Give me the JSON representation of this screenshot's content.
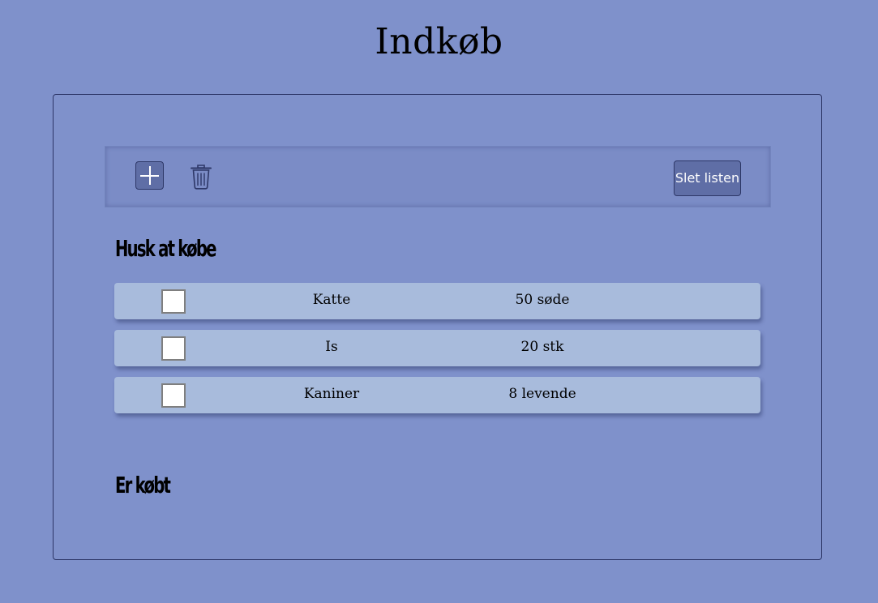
{
  "header": {
    "title": "Indkøb"
  },
  "toolbar": {
    "add_icon": "plus-icon",
    "delete_icon": "trash-icon",
    "clear_label": "Slet listen"
  },
  "sections": {
    "to_buy": {
      "heading": "Husk at købe",
      "items": [
        {
          "name": "Katte",
          "quantity": "50 søde",
          "checked": false
        },
        {
          "name": "Is",
          "quantity": "20 stk",
          "checked": false
        },
        {
          "name": "Kaniner",
          "quantity": "8 levende",
          "checked": false
        }
      ]
    },
    "bought": {
      "heading": "Er købt",
      "items": []
    }
  },
  "colors": {
    "background": "#7f91cb",
    "item_background": "#a8bbdc",
    "button_background": "#5f6ea6",
    "border": "#2c3566"
  }
}
